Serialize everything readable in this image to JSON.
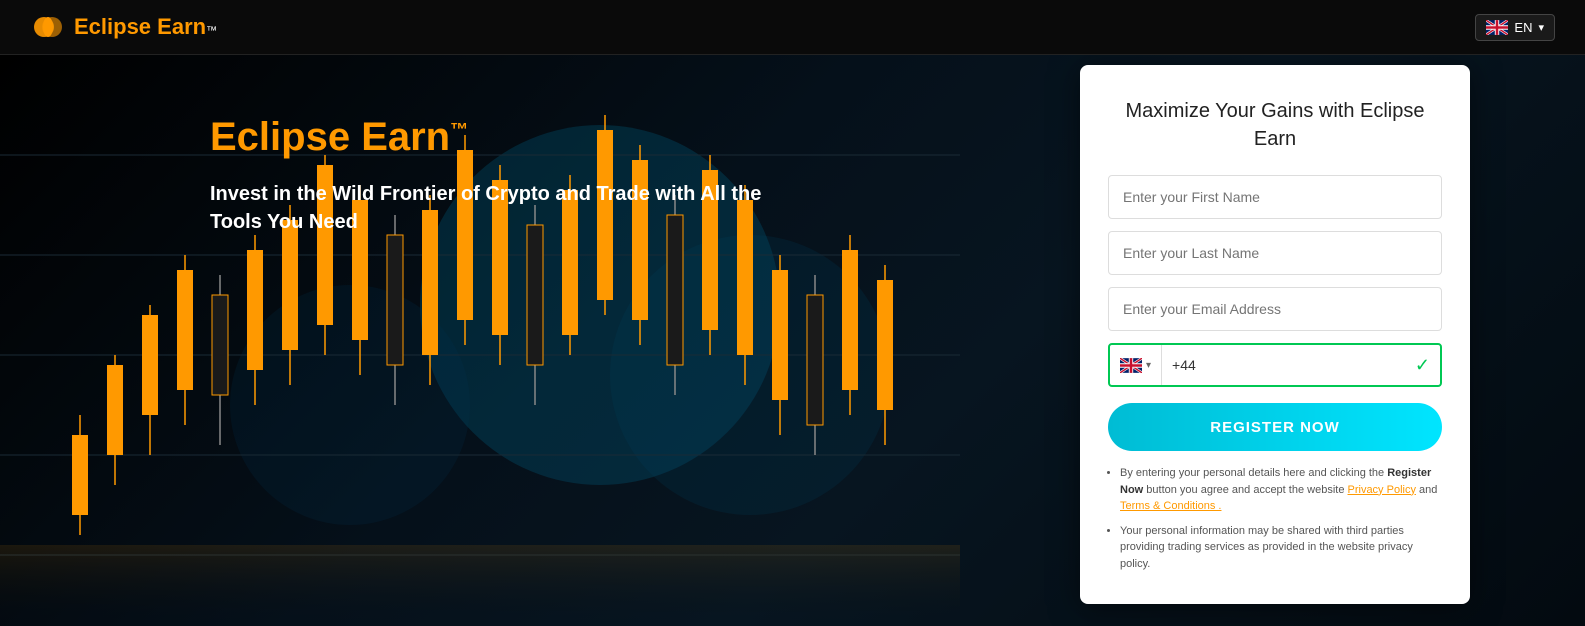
{
  "header": {
    "logo_brand": "Eclipse Earn",
    "logo_brand_colored": "Eclipse Earn",
    "logo_tm": "™",
    "lang_code": "EN"
  },
  "hero": {
    "title": "Eclipse Earn",
    "title_tm": "™",
    "subtitle_line1": "Invest in the Wild Frontier of Crypto and Trade with All the",
    "subtitle_line2": "Tools You Need"
  },
  "form": {
    "card_title": "Maximize Your Gains with Eclipse Earn",
    "first_name_placeholder": "Enter your First Name",
    "last_name_placeholder": "Enter your Last Name",
    "email_placeholder": "Enter your Email Address",
    "phone_code": "+44",
    "register_btn_label": "REGISTER NOW"
  },
  "disclaimer": {
    "text1_prefix": "By entering your personal details here and clicking the",
    "text1_bold": "Register Now",
    "text1_suffix": "button you agree and accept the website",
    "privacy_label": "Privacy Policy",
    "and_text": "and",
    "terms_label": "Terms & Conditions .",
    "text2": "Your personal information may be shared with third parties providing trading services as provided in the website privacy policy."
  },
  "icons": {
    "uk_flag": "🇬🇧",
    "checkmark": "✓",
    "chevron_down": "▾"
  }
}
